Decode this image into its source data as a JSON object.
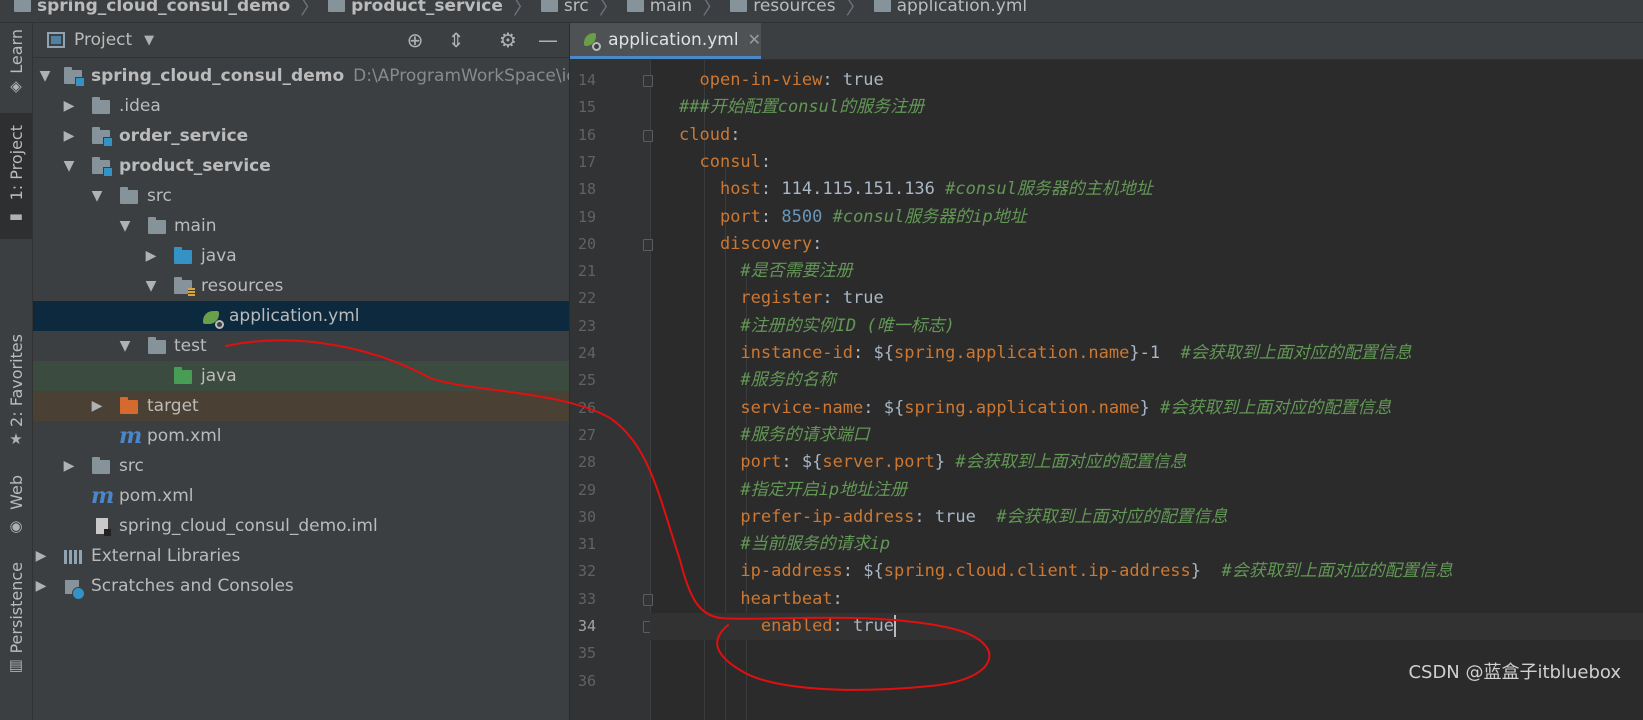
{
  "breadcrumb": {
    "items": [
      {
        "label": "spring_cloud_consul_demo",
        "bold": true
      },
      {
        "label": "product_service",
        "bold": true
      },
      {
        "label": "src",
        "bold": false
      },
      {
        "label": "main",
        "bold": false
      },
      {
        "label": "resources",
        "bold": false
      },
      {
        "label": "application.yml",
        "bold": false
      }
    ]
  },
  "tool_strip": {
    "learn": "Learn",
    "project": "1: Project",
    "favorites": "2: Favorites",
    "web": "Web",
    "persistence": "Persistence"
  },
  "project_panel": {
    "title": "Project",
    "tree": [
      {
        "label": "spring_cloud_consul_demo",
        "path": "D:\\AProgramWorkSpace\\idea\\test",
        "bold": true
      },
      {
        "label": ".idea"
      },
      {
        "label": "order_service",
        "bold": true
      },
      {
        "label": "product_service",
        "bold": true
      },
      {
        "label": "src"
      },
      {
        "label": "main"
      },
      {
        "label": "java"
      },
      {
        "label": "resources"
      },
      {
        "label": "application.yml"
      },
      {
        "label": "test"
      },
      {
        "label": "java"
      },
      {
        "label": "target"
      },
      {
        "label": "pom.xml"
      },
      {
        "label": "src"
      },
      {
        "label": "pom.xml"
      },
      {
        "label": "spring_cloud_consul_demo.iml"
      },
      {
        "label": "External Libraries"
      },
      {
        "label": "Scratches and Consoles"
      }
    ]
  },
  "editor": {
    "tab_label": "application.yml",
    "caret_line": 34,
    "lines": [
      {
        "n": "14",
        "t": [
          [
            "  ",
            "v"
          ],
          [
            "open-in-view",
            "k"
          ],
          [
            ": true",
            "v"
          ]
        ]
      },
      {
        "n": "15",
        "t": [
          [
            "###开始配置consul的服务注册",
            "c"
          ]
        ]
      },
      {
        "n": "16",
        "t": [
          [
            "cloud",
            "k"
          ],
          [
            ":",
            "v"
          ]
        ]
      },
      {
        "n": "17",
        "t": [
          [
            "  ",
            "v"
          ],
          [
            "consul",
            "k"
          ],
          [
            ":",
            "v"
          ]
        ]
      },
      {
        "n": "18",
        "t": [
          [
            "    ",
            "v"
          ],
          [
            "host",
            "k"
          ],
          [
            ": 114.115.151.136 ",
            "v"
          ],
          [
            "#consul服务器的主机地址",
            "c"
          ]
        ]
      },
      {
        "n": "19",
        "t": [
          [
            "    ",
            "v"
          ],
          [
            "port",
            "k"
          ],
          [
            ": ",
            "v"
          ],
          [
            "8500",
            "n"
          ],
          [
            " ",
            "v"
          ],
          [
            "#consul服务器的ip地址",
            "c"
          ]
        ]
      },
      {
        "n": "20",
        "t": [
          [
            "    ",
            "v"
          ],
          [
            "discovery",
            "k"
          ],
          [
            ":",
            "v"
          ]
        ]
      },
      {
        "n": "21",
        "t": [
          [
            "      ",
            "v"
          ],
          [
            "#是否需要注册",
            "c"
          ]
        ]
      },
      {
        "n": "22",
        "t": [
          [
            "      ",
            "v"
          ],
          [
            "register",
            "k"
          ],
          [
            ": true",
            "v"
          ]
        ]
      },
      {
        "n": "23",
        "t": [
          [
            "      ",
            "v"
          ],
          [
            "#注册的实例ID (唯一标志)",
            "c"
          ]
        ]
      },
      {
        "n": "24",
        "t": [
          [
            "      ",
            "v"
          ],
          [
            "instance-id",
            "k"
          ],
          [
            ": ${",
            "v"
          ],
          [
            "spring.application.name",
            "k"
          ],
          [
            "}-1  ",
            "v"
          ],
          [
            "#会获取到上面对应的配置信息",
            "c"
          ]
        ]
      },
      {
        "n": "25",
        "t": [
          [
            "      ",
            "v"
          ],
          [
            "#服务的名称",
            "c"
          ]
        ]
      },
      {
        "n": "26",
        "t": [
          [
            "      ",
            "v"
          ],
          [
            "service-name",
            "k"
          ],
          [
            ": ${",
            "v"
          ],
          [
            "spring.application.name",
            "k"
          ],
          [
            "} ",
            "v"
          ],
          [
            "#会获取到上面对应的配置信息",
            "c"
          ]
        ]
      },
      {
        "n": "27",
        "t": [
          [
            "      ",
            "v"
          ],
          [
            "#服务的请求端口",
            "c"
          ]
        ]
      },
      {
        "n": "28",
        "t": [
          [
            "      ",
            "v"
          ],
          [
            "port",
            "k"
          ],
          [
            ": ${",
            "v"
          ],
          [
            "server.port",
            "k"
          ],
          [
            "} ",
            "v"
          ],
          [
            "#会获取到上面对应的配置信息",
            "c"
          ]
        ]
      },
      {
        "n": "29",
        "t": [
          [
            "      ",
            "v"
          ],
          [
            "#指定开启ip地址注册",
            "c"
          ]
        ]
      },
      {
        "n": "30",
        "t": [
          [
            "      ",
            "v"
          ],
          [
            "prefer-ip-address",
            "k"
          ],
          [
            ": true  ",
            "v"
          ],
          [
            "#会获取到上面对应的配置信息",
            "c"
          ]
        ]
      },
      {
        "n": "31",
        "t": [
          [
            "      ",
            "v"
          ],
          [
            "#当前服务的请求ip",
            "c"
          ]
        ]
      },
      {
        "n": "32",
        "t": [
          [
            "      ",
            "v"
          ],
          [
            "ip-address",
            "k"
          ],
          [
            ": ${",
            "v"
          ],
          [
            "spring.cloud.client.ip-address",
            "k"
          ],
          [
            "}  ",
            "v"
          ],
          [
            "#会获取到上面对应的配置信息",
            "c"
          ]
        ]
      },
      {
        "n": "33",
        "t": [
          [
            "      ",
            "v"
          ],
          [
            "heartbeat",
            "k"
          ],
          [
            ":",
            "v"
          ]
        ]
      },
      {
        "n": "34",
        "t": [
          [
            "        ",
            "v"
          ],
          [
            "enabled",
            "k"
          ],
          [
            ": true",
            "v"
          ]
        ]
      },
      {
        "n": "35",
        "t": []
      },
      {
        "n": "36",
        "t": []
      }
    ]
  },
  "watermark": "CSDN @蓝盒子itbluebox",
  "colors": {
    "keyword": "#cc7832",
    "comment": "#629755",
    "number": "#6897bb",
    "annotation_ink": "#e01010"
  }
}
